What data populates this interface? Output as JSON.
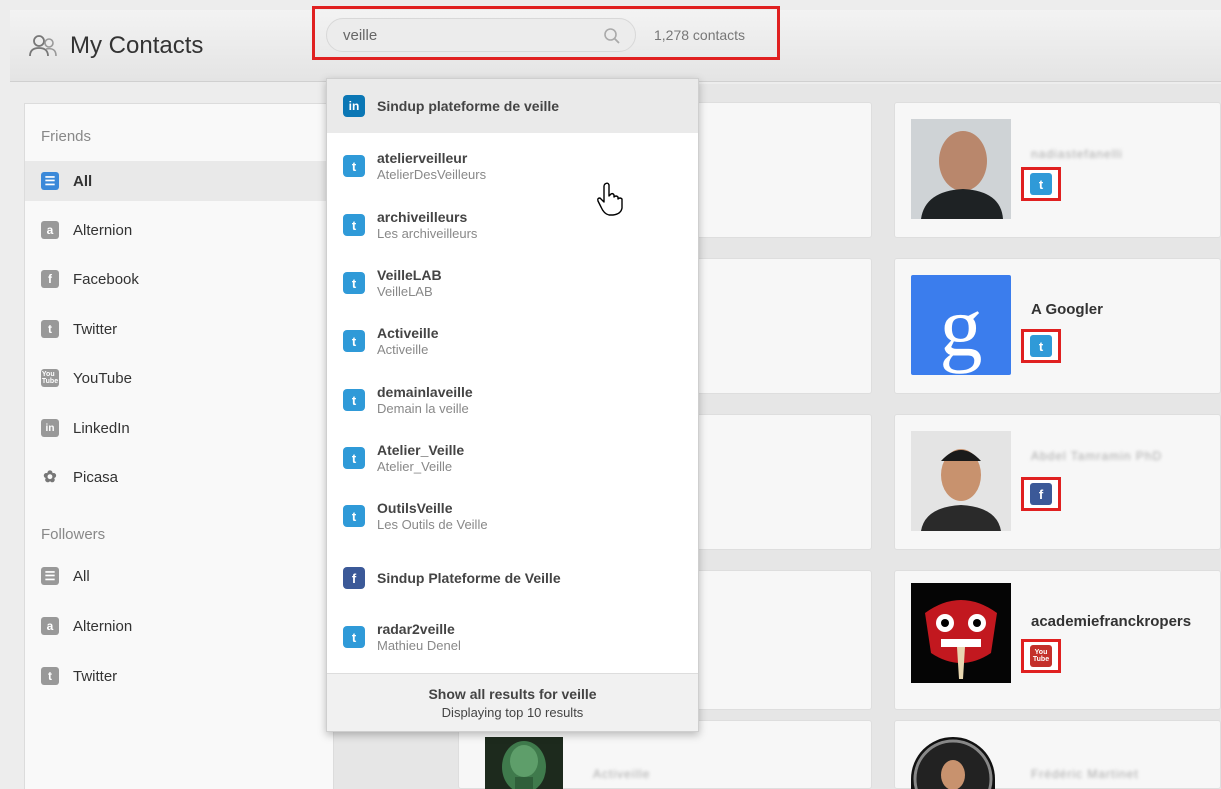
{
  "header": {
    "title": "My Contacts",
    "search_value": "veille",
    "contact_count": "1,278 contacts"
  },
  "sidebar": {
    "friends_title": "Friends",
    "friends": [
      {
        "label": "All",
        "icon": "list-icon",
        "active": true
      },
      {
        "label": "Alternion",
        "icon": "alternion-icon"
      },
      {
        "label": "Facebook",
        "icon": "facebook-icon"
      },
      {
        "label": "Twitter",
        "icon": "twitter-icon"
      },
      {
        "label": "YouTube",
        "icon": "youtube-icon"
      },
      {
        "label": "LinkedIn",
        "icon": "linkedin-icon"
      },
      {
        "label": "Picasa",
        "icon": "picasa-icon"
      }
    ],
    "followers_title": "Followers",
    "followers": [
      {
        "label": "All",
        "icon": "list-icon"
      },
      {
        "label": "Alternion",
        "icon": "alternion-icon"
      },
      {
        "label": "Twitter",
        "icon": "twitter-icon"
      }
    ]
  },
  "dropdown": {
    "items": [
      {
        "primary": "Sindup plateforme de veille",
        "secondary": "",
        "network": "linkedin"
      },
      {
        "primary": "atelierveilleur",
        "secondary": "AtelierDesVeilleurs",
        "network": "twitter"
      },
      {
        "primary": "archiveilleurs",
        "secondary": "Les archiveilleurs",
        "network": "twitter"
      },
      {
        "primary": "VeilleLAB",
        "secondary": "VeilleLAB",
        "network": "twitter"
      },
      {
        "primary": "Activeille",
        "secondary": "Activeille",
        "network": "twitter"
      },
      {
        "primary": "demainlaveille",
        "secondary": "Demain la veille",
        "network": "twitter"
      },
      {
        "primary": "Atelier_Veille",
        "secondary": "Atelier_Veille",
        "network": "twitter"
      },
      {
        "primary": "OutilsVeille",
        "secondary": "Les Outils de Veille",
        "network": "twitter"
      },
      {
        "primary": "Sindup Plateforme de Veille",
        "secondary": "",
        "network": "facebook"
      },
      {
        "primary": "radar2veille",
        "secondary": "Mathieu Denel",
        "network": "twitter"
      }
    ],
    "footer_show_all": "Show all results for veille",
    "footer_displaying": "Displaying top 10 results"
  },
  "contacts": {
    "card1_name": "nadiastefanelli",
    "card2_name": "A Googler",
    "card3_name": "Abdel Tamramin PhD",
    "card4_name": "academiefranckropers",
    "card5_name": "Activeille",
    "card6_name": "Frédéric Martinet"
  },
  "colors": {
    "twitter": "#2f9ad8",
    "facebook": "#3b5998",
    "linkedin": "#0b77b5",
    "youtube": "#c4302b",
    "highlight_border": "#e02020"
  }
}
